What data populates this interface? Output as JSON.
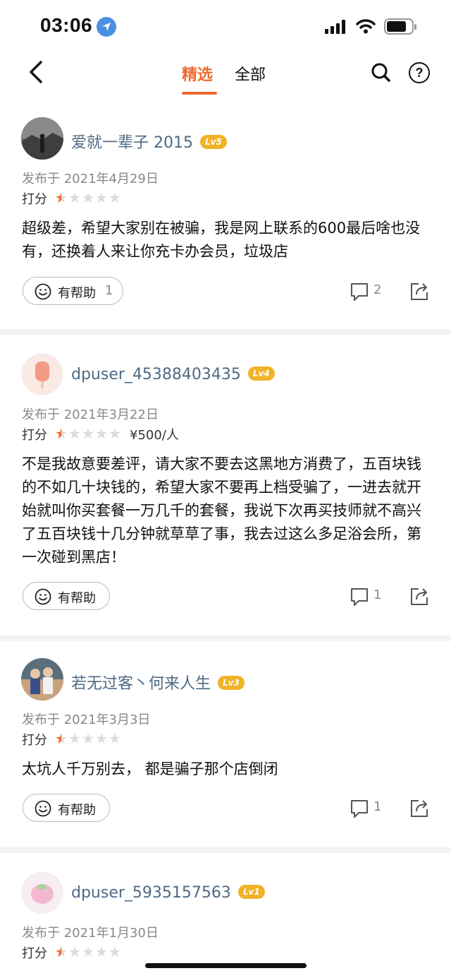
{
  "status_bar": {
    "time": "03:06"
  },
  "nav": {
    "tabs": [
      {
        "label": "精选",
        "active": true
      },
      {
        "label": "全部",
        "active": false
      }
    ]
  },
  "colors": {
    "accent": "#ee6a2f",
    "username": "#4e6a85",
    "level_badge": "#f0b226",
    "star": "#ee6a2f"
  },
  "reviews": [
    {
      "username": "爱就一辈子 2015",
      "level": "Lv5",
      "date": "发布于 2021年4月29日",
      "score_label": "打分",
      "rating": 0.5,
      "price": "",
      "content": "超级差，希望大家别在被骗，我是网上联系的600最后啥也没有，还换着人来让你充卡办会员，垃圾店",
      "helpful_label": "有帮助",
      "helpful_count": "1",
      "comment_count": "2"
    },
    {
      "username": "dpuser_45388403435",
      "level": "Lv4",
      "date": "发布于 2021年3月22日",
      "score_label": "打分",
      "rating": 0.5,
      "price": "¥500/人",
      "content": "不是我故意要差评，请大家不要去这黑地方消费了，五百块钱的不如几十块钱的，希望大家不要再上档受骗了，一进去就开始就叫你买套餐一万几千的套餐，我说下次再买技师就不高兴了五百块钱十几分钟就草草了事，我去过这么多足浴会所，第一次碰到黑店！",
      "helpful_label": "有帮助",
      "helpful_count": "",
      "comment_count": "1"
    },
    {
      "username": "若无过客丶何来人生",
      "level": "Lv3",
      "date": "发布于 2021年3月3日",
      "score_label": "打分",
      "rating": 0.5,
      "price": "",
      "content": "太坑人千万别去， 都是骗子那个店倒闭",
      "helpful_label": "有帮助",
      "helpful_count": "",
      "comment_count": "1"
    },
    {
      "username": "dpuser_5935157563",
      "level": "Lv1",
      "date": "发布于 2021年1月30日",
      "score_label": "打分",
      "rating": 0.5,
      "price": "",
      "content": "",
      "helpful_label": "",
      "helpful_count": "",
      "comment_count": ""
    }
  ]
}
